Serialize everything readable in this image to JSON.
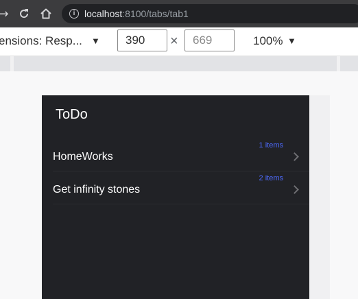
{
  "browser": {
    "url_host": "localhost",
    "url_path": ":8100/tabs/tab1"
  },
  "device_toolbar": {
    "dimensions_label": "ensions: Resp...",
    "width": "390",
    "height": "669",
    "times": "×",
    "zoom": "100%"
  },
  "app": {
    "title": "ToDo",
    "items": [
      {
        "label": "HomeWorks",
        "count": "1 items"
      },
      {
        "label": "Get infinity stones",
        "count": "2 items"
      }
    ]
  }
}
